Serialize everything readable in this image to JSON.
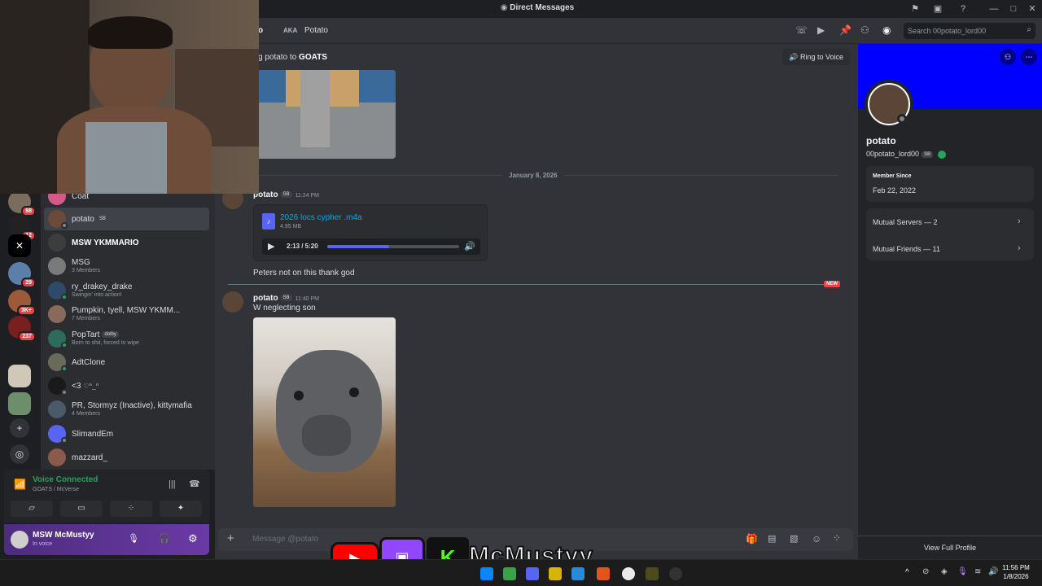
{
  "window": {
    "title": "Direct Messages"
  },
  "header": {
    "name_partial": "o",
    "aka_label": "AKA",
    "aka_value": "Potato",
    "search_placeholder": "Search 00potato_lord00"
  },
  "ring": {
    "text_prefix": "g potato to ",
    "text_bold": "GOATS",
    "button": "Ring to Voice"
  },
  "servers": [
    {
      "badge": "98"
    },
    {
      "badge": "12"
    },
    {
      "badge": ""
    },
    {
      "badge": "29"
    },
    {
      "badge": "3K+"
    },
    {
      "badge": "237"
    },
    {
      "badge": ""
    },
    {
      "badge": ""
    }
  ],
  "dms": [
    {
      "name": "Coat",
      "sub": "",
      "tag": ""
    },
    {
      "name": "potato",
      "sub": "",
      "tag": "SB"
    },
    {
      "name": "MSW YKMMARIO",
      "sub": "",
      "tag": ""
    },
    {
      "name": "MSG",
      "sub": "3 Members",
      "tag": ""
    },
    {
      "name": "ry_drakey_drake",
      "sub": "Swingin' into action!",
      "tag": ""
    },
    {
      "name": "Pumpkin, tyell, MSW YKMM...",
      "sub": "7 Members",
      "tag": ""
    },
    {
      "name": "PopTart",
      "sub": "Born to shit, forced to wipe",
      "tag": "dolby"
    },
    {
      "name": "AdtClone",
      "sub": "",
      "tag": ""
    },
    {
      "name": "<3",
      "sub": "",
      "tag": ""
    },
    {
      "name": "PR, Stormyz (Inactive), kittymafia",
      "sub": "4 Members",
      "tag": ""
    },
    {
      "name": "SlimandEm",
      "sub": "",
      "tag": ""
    },
    {
      "name": "mazzard_",
      "sub": "",
      "tag": ""
    }
  ],
  "voice": {
    "status": "Voice Connected",
    "channel": "GOATS / McVerse"
  },
  "user": {
    "name": "MSW McMustyy",
    "status": "In voice"
  },
  "chat": {
    "date_divider": "January 8, 2026",
    "msg1": {
      "author": "potato",
      "tag": "SB",
      "time": "11:24 PM",
      "file_name": "2026 locs cypher .m4a",
      "file_size": "4.95 MB",
      "player_time": "2:13 / 5:20",
      "progress": 0.47
    },
    "msg1_followup": "Peters not on this thank god",
    "new_label": "NEW",
    "msg2": {
      "author": "potato",
      "tag": "SB",
      "time": "11:40 PM",
      "text": "W neglecting son"
    },
    "composer_placeholder": "Message @potato"
  },
  "profile": {
    "display_name": "potato",
    "username": "00potato_lord00",
    "tag": "SB",
    "member_since_label": "Member Since",
    "member_since_value": "Feb 22, 2022",
    "mutual_servers": "Mutual Servers — 2",
    "mutual_friends": "Mutual Friends — 11",
    "view_full": "View Full Profile"
  },
  "overlay": {
    "brand": "McMustyy"
  },
  "taskbar": {
    "time": "11:56 PM",
    "date": "1/8/2026"
  },
  "colors": {
    "accent": "#5865f2",
    "online": "#23a55a",
    "new": "#f23f43",
    "banner": "#0000ff"
  }
}
